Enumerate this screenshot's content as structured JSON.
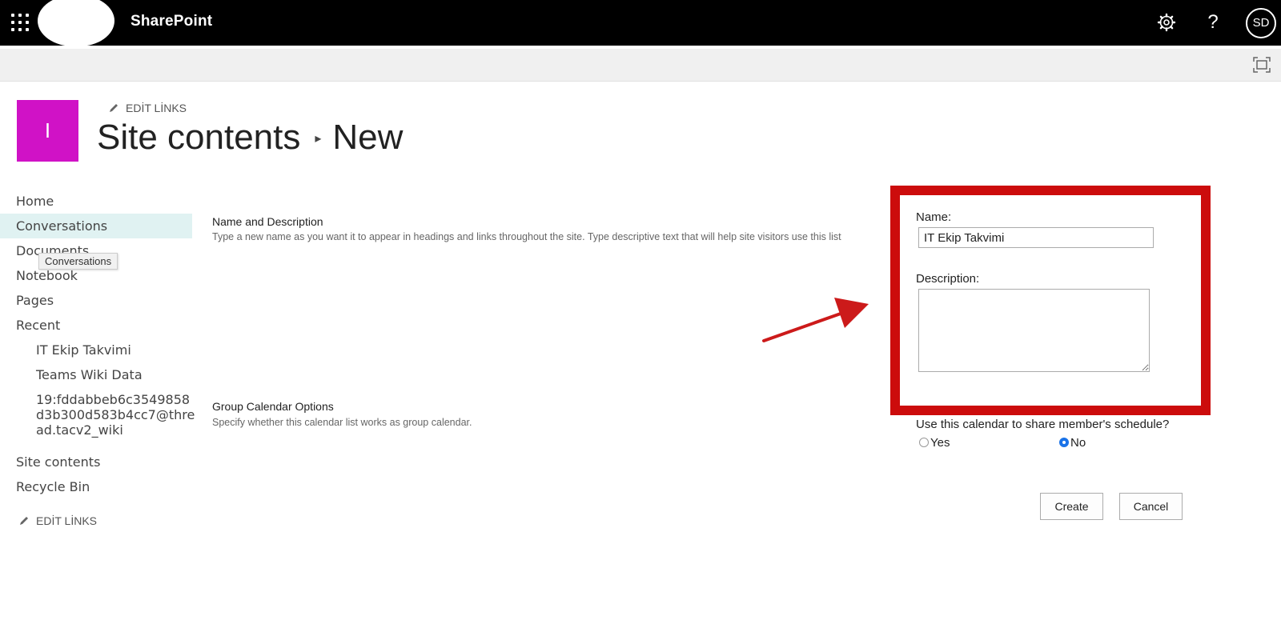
{
  "suite": {
    "app_name": "SharePoint",
    "avatar_initials": "SD",
    "help_glyph": "?"
  },
  "site": {
    "logo_letter": "I",
    "logo_color": "#d012c6",
    "edit_links": "EDİT LİNKS",
    "title_parent": "Site contents",
    "title_separator": "▸",
    "title_current": "New"
  },
  "leftnav": {
    "items": [
      {
        "label": "Home"
      },
      {
        "label": "Conversations"
      },
      {
        "label": "Documents"
      },
      {
        "label": "Notebook"
      },
      {
        "label": "Pages"
      },
      {
        "label": "Recent"
      },
      {
        "label": "IT Ekip Takvimi"
      },
      {
        "label": "Teams Wiki Data"
      },
      {
        "label": "19:fddabbeb6c3549858 d3b300d583b4cc7@thre ad.tacv2_wiki",
        "lines": [
          "19:fddabbeb6c3549858",
          "d3b300d583b4cc7@thre",
          "ad.tacv2_wiki"
        ]
      },
      {
        "label": "Site contents"
      },
      {
        "label": "Recycle Bin"
      }
    ],
    "tooltip": "Conversations",
    "edit_links": "EDİT LİNKS"
  },
  "form": {
    "section1_title": "Name and Description",
    "section1_desc": "Type a new name as you want it to appear in headings and links throughout the site. Type descriptive text that will help site visitors use this list",
    "section2_title": "Group Calendar Options",
    "section2_desc": "Specify whether this calendar list works as group calendar.",
    "name_label": "Name:",
    "name_value": "IT Ekip Takvimi",
    "description_label": "Description:",
    "description_value": "",
    "question": "Use this calendar to share member's schedule?",
    "option_yes": "Yes",
    "option_no": "No",
    "selected_option": "No",
    "create_label": "Create",
    "cancel_label": "Cancel"
  },
  "annotation": {
    "highlight_color": "#cc0c0c"
  }
}
